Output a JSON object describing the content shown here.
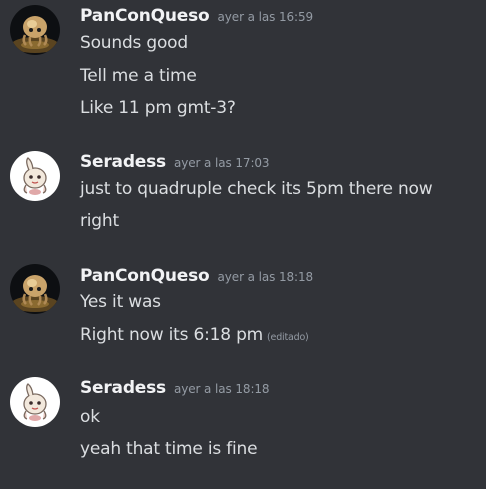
{
  "messages": [
    {
      "username": "PanConQueso",
      "timestamp": "ayer a las 16:59",
      "lines": [
        "Sounds good",
        "Tell me a time",
        "Like 11 pm gmt-3?"
      ]
    },
    {
      "username": "Seradess",
      "timestamp": "ayer a las 17:03",
      "lines": [
        "just to quadruple check its 5pm there now",
        "right"
      ]
    },
    {
      "username": "PanConQueso",
      "timestamp": "ayer a las 18:18",
      "lines": [
        "Yes it was",
        "Right now its 6:18 pm"
      ],
      "edited_label": "(editado)"
    },
    {
      "username": "Seradess",
      "timestamp": "ayer a las 18:18",
      "lines": [
        "ok",
        "yeah that time is fine"
      ]
    }
  ]
}
